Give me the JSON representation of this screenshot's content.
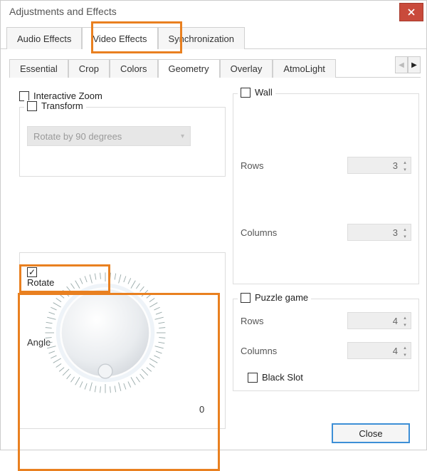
{
  "window": {
    "title": "Adjustments and Effects"
  },
  "tabs": {
    "top": [
      "Audio Effects",
      "Video Effects",
      "Synchronization"
    ],
    "top_active": 1,
    "sub": [
      "Essential",
      "Crop",
      "Colors",
      "Geometry",
      "Overlay",
      "AtmoLight"
    ],
    "sub_active": 3
  },
  "left": {
    "interactive_zoom": {
      "label": "Interactive Zoom",
      "checked": false
    },
    "transform": {
      "label": "Transform",
      "checked": false,
      "dropdown_value": "Rotate by 90 degrees"
    },
    "rotate": {
      "label": "Rotate",
      "checked": true,
      "angle_label": "Angle",
      "angle_value": 0,
      "zero_label": "0"
    }
  },
  "right": {
    "wall": {
      "label": "Wall",
      "checked": false,
      "rows_label": "Rows",
      "rows_value": 3,
      "columns_label": "Columns",
      "columns_value": 3
    },
    "puzzle": {
      "label": "Puzzle game",
      "checked": false,
      "rows_label": "Rows",
      "rows_value": 4,
      "columns_label": "Columns",
      "columns_value": 4,
      "black_slot_label": "Black Slot",
      "black_slot_checked": false
    }
  },
  "buttons": {
    "close": "Close"
  },
  "colors": {
    "highlight": "#e98020",
    "close_bg": "#c94a3b",
    "accent": "#3d8fd6"
  }
}
